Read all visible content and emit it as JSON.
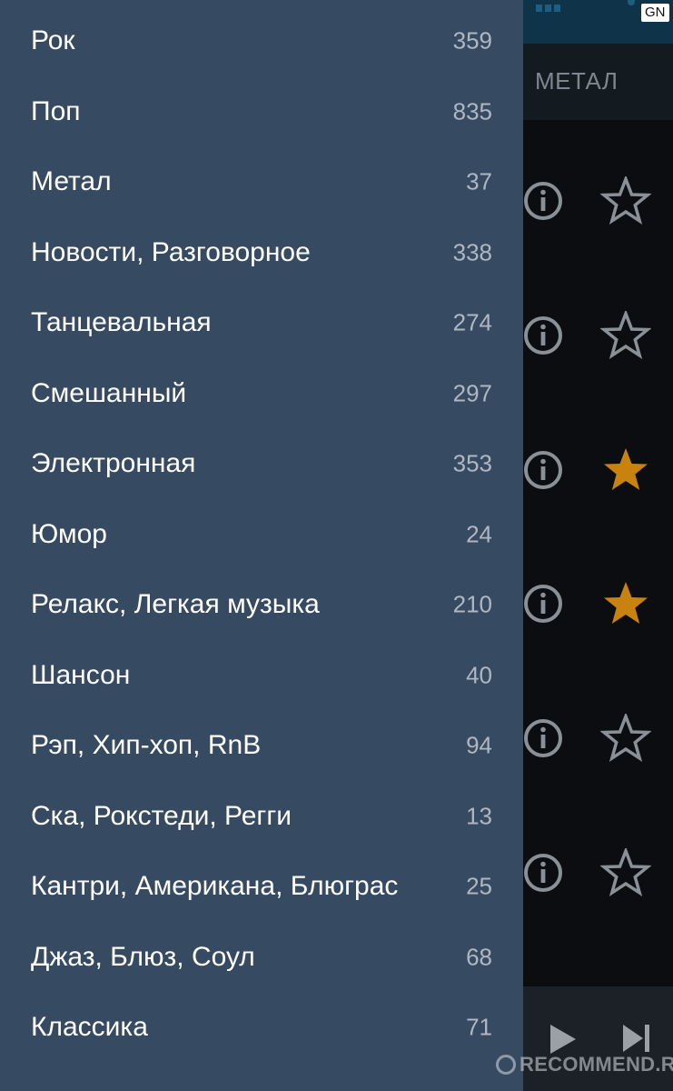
{
  "background": {
    "status_badge": "GN",
    "visible_tab": "МЕТАЛ",
    "rows": [
      {
        "info_icon": "info-icon",
        "favorite": false
      },
      {
        "info_icon": "info-icon",
        "favorite": false
      },
      {
        "info_icon": "info-icon",
        "favorite": true
      },
      {
        "info_icon": "info-icon",
        "favorite": true
      },
      {
        "info_icon": "info-icon",
        "favorite": false
      },
      {
        "info_icon": "info-icon",
        "favorite": false
      }
    ],
    "player_icons": [
      "play-icon",
      "skip-next-icon"
    ]
  },
  "drawer": {
    "genres": [
      {
        "label": "Рок",
        "count": "359"
      },
      {
        "label": "Поп",
        "count": "835"
      },
      {
        "label": "Метал",
        "count": "37"
      },
      {
        "label": "Новости, Разговорное",
        "count": "338"
      },
      {
        "label": "Танцевальная",
        "count": "274"
      },
      {
        "label": "Смешанный",
        "count": "297"
      },
      {
        "label": "Электронная",
        "count": "353"
      },
      {
        "label": "Юмор",
        "count": "24"
      },
      {
        "label": "Релакс, Легкая музыка",
        "count": "210"
      },
      {
        "label": "Шансон",
        "count": "40"
      },
      {
        "label": "Рэп, Хип-хоп, RnB",
        "count": "94"
      },
      {
        "label": "Ска, Рокстеди, Регги",
        "count": "13"
      },
      {
        "label": "Кантри, Американа, Блюграс",
        "count": "25"
      },
      {
        "label": "Джаз, Блюз, Соул",
        "count": "68"
      },
      {
        "label": "Классика",
        "count": "71"
      }
    ]
  },
  "watermark": "RECOMMEND.RU",
  "colors": {
    "drawer_bg": "#364a62",
    "favorite_star": "#c8830f",
    "icon_gray": "#8a9096"
  }
}
